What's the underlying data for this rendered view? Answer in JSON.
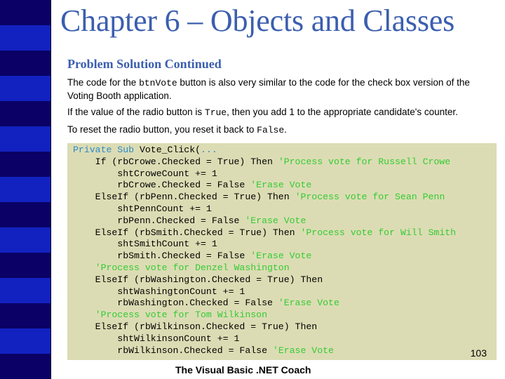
{
  "slide": {
    "title": "Chapter 6 – Objects and Classes",
    "subtitle": "Problem Solution Continued",
    "paragraphs": [
      {
        "before": "The code for the ",
        "code": "btnVote",
        "after": " button is also very similar to the code for the check box version of the Voting Booth application."
      },
      {
        "before": "If the value of the radio button is ",
        "code": "True",
        "after": ", then you add 1 to the appropriate candidate's counter."
      },
      {
        "before": "To reset the radio button, you reset it back to ",
        "code": "False",
        "after": "."
      }
    ],
    "code_lines": [
      [
        {
          "t": "kw",
          "s": "Private Sub"
        },
        {
          "t": "n",
          "s": " Vote_Click("
        },
        {
          "t": "kw",
          "s": "..."
        }
      ],
      [
        {
          "t": "n",
          "s": "    If (rbCrowe.Checked = True) Then "
        },
        {
          "t": "cm",
          "s": "'Process vote for Russell Crowe"
        }
      ],
      [
        {
          "t": "n",
          "s": "        shtCroweCount += 1"
        }
      ],
      [
        {
          "t": "n",
          "s": "        rbCrowe.Checked = False "
        },
        {
          "t": "cm",
          "s": "'Erase Vote"
        }
      ],
      [
        {
          "t": "n",
          "s": "    ElseIf (rbPenn.Checked = True) Then "
        },
        {
          "t": "cm",
          "s": "'Process vote for Sean Penn"
        }
      ],
      [
        {
          "t": "n",
          "s": "        shtPennCount += 1"
        }
      ],
      [
        {
          "t": "n",
          "s": "        rbPenn.Checked = False "
        },
        {
          "t": "cm",
          "s": "'Erase Vote"
        }
      ],
      [
        {
          "t": "n",
          "s": "    ElseIf (rbSmith.Checked = True) Then "
        },
        {
          "t": "cm",
          "s": "'Process vote for Will Smith"
        }
      ],
      [
        {
          "t": "n",
          "s": "        shtSmithCount += 1"
        }
      ],
      [
        {
          "t": "n",
          "s": "        rbSmith.Checked = False "
        },
        {
          "t": "cm",
          "s": "'Erase Vote"
        }
      ],
      [
        {
          "t": "n",
          "s": "    "
        },
        {
          "t": "cm",
          "s": "'Process vote for Denzel Washington"
        }
      ],
      [
        {
          "t": "n",
          "s": "    ElseIf (rbWashington.Checked = True) Then"
        }
      ],
      [
        {
          "t": "n",
          "s": "        shtWashingtonCount += 1"
        }
      ],
      [
        {
          "t": "n",
          "s": "        rbWashington.Checked = False "
        },
        {
          "t": "cm",
          "s": "'Erase Vote"
        }
      ],
      [
        {
          "t": "n",
          "s": "    "
        },
        {
          "t": "cm",
          "s": "'Process vote for Tom Wilkinson"
        }
      ],
      [
        {
          "t": "n",
          "s": "    ElseIf (rbWilkinson.Checked = True) Then"
        }
      ],
      [
        {
          "t": "n",
          "s": "        shtWilkinsonCount += 1"
        }
      ],
      [
        {
          "t": "n",
          "s": "        rbWilkinson.Checked = False "
        },
        {
          "t": "cm",
          "s": "'Erase Vote"
        }
      ]
    ],
    "page_number": "103",
    "footer": "The Visual Basic .NET Coach"
  },
  "colors": {
    "title": "#3b5eaf",
    "sidebar_dark": "#0a0066",
    "sidebar_bright": "#1222c0",
    "code_background": "#dcdcb4",
    "code_keyword": "#2a8bc8",
    "code_comment": "#33cc33"
  }
}
